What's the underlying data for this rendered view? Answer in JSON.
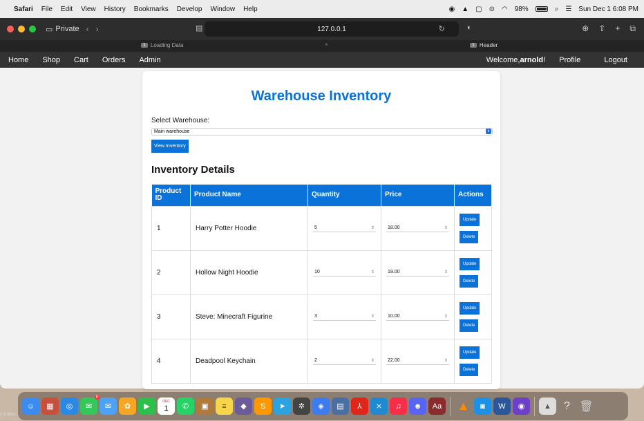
{
  "menubar": {
    "app": "Safari",
    "items": [
      "File",
      "Edit",
      "View",
      "History",
      "Bookmarks",
      "Develop",
      "Window",
      "Help"
    ],
    "battery": "98%",
    "datetime": "Sun Dec 1  6:08 PM"
  },
  "browser": {
    "private_label": "Private",
    "url": "127.0.0.1",
    "tabs": [
      {
        "num": "1",
        "label": "Loading Data"
      },
      {
        "num": "1",
        "label": "Header"
      }
    ]
  },
  "nav": {
    "links": [
      "Home",
      "Shop",
      "Cart",
      "Orders",
      "Admin"
    ],
    "welcome_prefix": "Welcome,",
    "username": "arnold",
    "welcome_suffix": "!",
    "profile": "Profile",
    "logout": "Logout"
  },
  "page": {
    "title": "Warehouse Inventory",
    "select_label": "Select Warehouse:",
    "selected_warehouse": "Main warehouse",
    "view_button": "View Inventory",
    "section_title": "Inventory Details",
    "columns": [
      "Product ID",
      "Product Name",
      "Quantity",
      "Price",
      "Actions"
    ],
    "rows": [
      {
        "id": "1",
        "name": "Harry Potter Hoodie",
        "quantity": "5",
        "price": "18.00"
      },
      {
        "id": "2",
        "name": "Hollow Night Hoodie",
        "quantity": "10",
        "price": "19.00"
      },
      {
        "id": "3",
        "name": "Steve: Minecraft Figurine",
        "quantity": "3",
        "price": "10.00"
      },
      {
        "id": "4",
        "name": "Deadpool Keychain",
        "quantity": "2",
        "price": "22.00"
      }
    ],
    "update_label": "Update",
    "delete_label": "Delete"
  },
  "colors": {
    "accent": "#0a72d9",
    "nav_bg": "#333333"
  },
  "dock": {
    "icons": [
      "finder-icon",
      "launchpad-icon",
      "safari-icon",
      "messages-icon",
      "mail-icon",
      "photos-icon",
      "facetime-icon",
      "calendar-icon",
      "whatsapp-icon",
      "app-icon",
      "notes-icon",
      "matlab-icon",
      "sublime-icon",
      "telegram-icon",
      "chatgpt-icon",
      "vscode-alt-icon",
      "tableplus-icon",
      "acrobat-icon",
      "vscode-icon",
      "music-icon",
      "discord-icon",
      "dictionary-icon",
      "vlc-icon",
      "docker-icon",
      "word-icon",
      "github-icon",
      "preview-icon",
      "help-icon",
      "trash-icon"
    ],
    "calendar_month": "DEC",
    "calendar_day": "1",
    "messages_badge": "8"
  },
  "corner_text": "y & Bloo..."
}
